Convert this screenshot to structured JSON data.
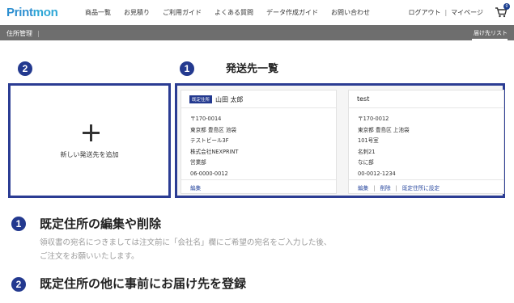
{
  "header": {
    "logo_part1": "Print",
    "logo_part2": "mon",
    "nav": [
      "商品一覧",
      "お見積り",
      "ご利用ガイド",
      "よくある質問",
      "データ作成ガイド",
      "お問い合わせ"
    ],
    "logout": "ログアウト",
    "separator": "|",
    "mypage": "マイページ",
    "cart_count": "0"
  },
  "subbar": {
    "title": "住所管理",
    "pipe": "|",
    "tab": "届け先リスト"
  },
  "markers": {
    "one": "1",
    "two": "2"
  },
  "list_heading": "発送先一覧",
  "add_card": {
    "label": "新しい発送先を追加"
  },
  "addresses": [
    {
      "badge": "既定住所",
      "name": "山田 太郎",
      "lines": [
        "〒170-0014",
        "東京都 豊島区 池袋",
        "テストビール3F",
        "株式会社NEXPRINT",
        "営業部",
        "06-0000-0012"
      ],
      "actions": [
        "編集"
      ]
    },
    {
      "badge": "",
      "name": "test",
      "lines": [
        "〒170-0012",
        "東京都 豊島区 上池袋",
        "101号室",
        "名刺21",
        "なに部",
        "00-0012-1234"
      ],
      "actions": [
        "編集",
        "削除",
        "既定住所に設定"
      ]
    }
  ],
  "section1": {
    "num": "1",
    "title": "既定住所の編集や削除",
    "desc_line1": "領収書の宛名につきましては注文前に「会社名」欄にご希望の宛名をご入力した後、",
    "desc_line2": "ご注文をお願いいたします。"
  },
  "section2": {
    "num": "2",
    "title": "既定住所の他に事前にお届け先を登録"
  }
}
